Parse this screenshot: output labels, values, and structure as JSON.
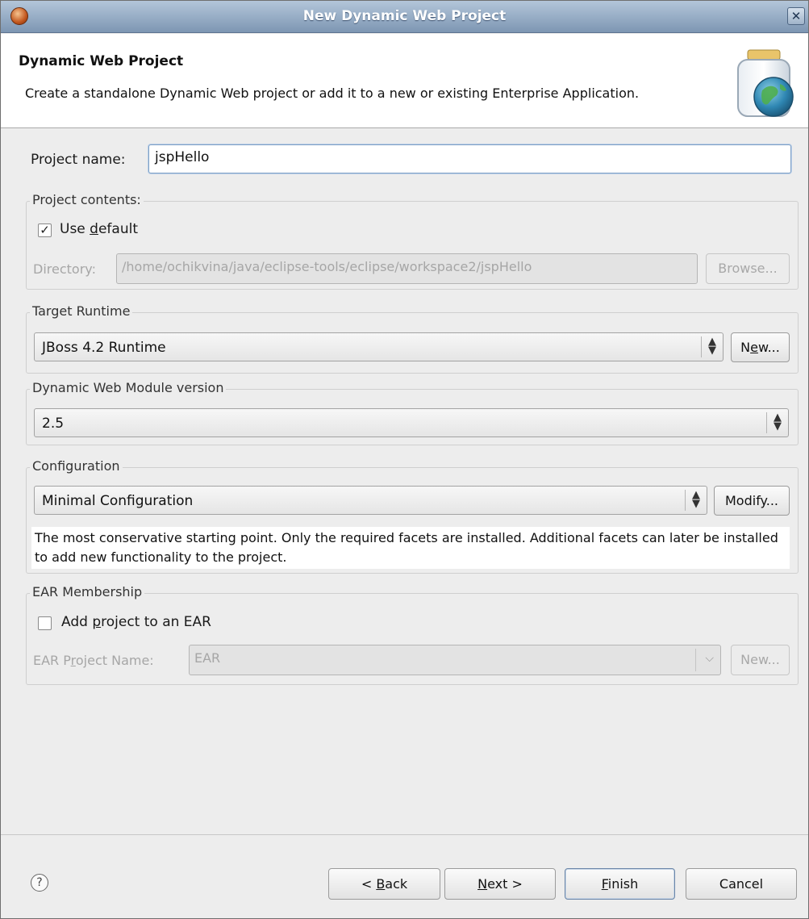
{
  "window": {
    "title": "New Dynamic Web Project",
    "close_glyph": "✕",
    "app_icon": "eclipse-icon"
  },
  "header": {
    "title": "Dynamic Web Project",
    "description": "Create a standalone Dynamic Web project or add it to a new or existing Enterprise Application.",
    "banner_icon": "jar-globe-icon"
  },
  "project_name": {
    "label": "Project name:",
    "value": "jspHello"
  },
  "project_contents": {
    "title": "Project contents:",
    "use_default_label_pre": "Use ",
    "use_default_mnemonic": "d",
    "use_default_label_post": "efault",
    "use_default_checked": true,
    "directory_label": "Directory:",
    "directory_value": "/home/ochikvina/java/eclipse-tools/eclipse/workspace2/jspHello",
    "browse_label": "Browse..."
  },
  "target_runtime": {
    "title": "Target Runtime",
    "selected": "JBoss 4.2 Runtime",
    "new_pre": "N",
    "new_mnemonic": "e",
    "new_post": "w..."
  },
  "module_version": {
    "title": "Dynamic Web Module version",
    "selected": "2.5"
  },
  "configuration": {
    "title": "Configuration",
    "selected": "Minimal Configuration",
    "modify_label": "Modify...",
    "description": "The most conservative starting point. Only the required facets are installed. Additional facets can later be installed to add new functionality to the project."
  },
  "ear_membership": {
    "title": "EAR Membership",
    "add_label_pre": "Add ",
    "add_mnemonic": "p",
    "add_label_post": "roject to an EAR",
    "add_checked": false,
    "ear_name_label_pre": "EAR P",
    "ear_name_mnemonic": "r",
    "ear_name_label_post": "oject Name:",
    "ear_name_value": "EAR",
    "new_label": "New..."
  },
  "footer": {
    "help_glyph": "?",
    "back_pre": "< ",
    "back_mnemonic": "B",
    "back_post": "ack",
    "next_mnemonic": "N",
    "next_post": "ext >",
    "finish_mnemonic": "F",
    "finish_post": "inish",
    "cancel_label": "Cancel"
  }
}
